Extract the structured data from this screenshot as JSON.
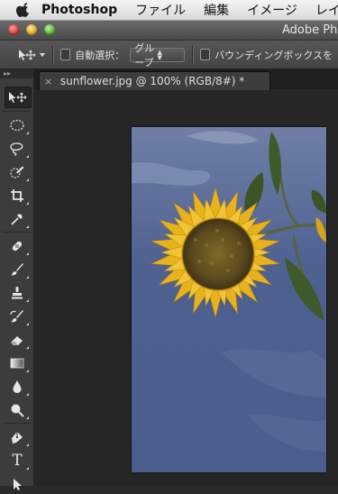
{
  "menubar": {
    "apple_icon": "apple-icon",
    "items": [
      "Photoshop",
      "ファイル",
      "編集",
      "イメージ",
      "レイ"
    ]
  },
  "window": {
    "title": "Adobe Pho"
  },
  "options": {
    "auto_select_label": "自動選択：",
    "auto_select_value": "グループ",
    "bounding_box_label": "バウンディングボックスを"
  },
  "toolbar": {
    "header": "▸▸",
    "tools": [
      {
        "name": "move-tool",
        "icon": "move-icon",
        "active": true
      },
      {
        "name": "marquee-tool",
        "icon": "elliptical-marquee-icon"
      },
      {
        "name": "lasso-tool",
        "icon": "lasso-icon"
      },
      {
        "name": "quick-selection-tool",
        "icon": "quick-selection-icon"
      },
      {
        "name": "crop-tool",
        "icon": "crop-icon"
      },
      {
        "name": "eyedropper-tool",
        "icon": "eyedropper-icon"
      },
      {
        "name": "healing-brush-tool",
        "icon": "bandage-icon"
      },
      {
        "name": "brush-tool",
        "icon": "brush-icon"
      },
      {
        "name": "clone-stamp-tool",
        "icon": "stamp-icon"
      },
      {
        "name": "history-brush-tool",
        "icon": "history-brush-icon"
      },
      {
        "name": "eraser-tool",
        "icon": "eraser-icon"
      },
      {
        "name": "gradient-tool",
        "icon": "gradient-icon"
      },
      {
        "name": "blur-tool",
        "icon": "blur-drop-icon"
      },
      {
        "name": "dodge-tool",
        "icon": "dodge-icon"
      },
      {
        "name": "pen-tool",
        "icon": "pen-icon"
      },
      {
        "name": "type-tool",
        "icon": "type-icon",
        "label": "T"
      },
      {
        "name": "path-selection-tool",
        "icon": "path-selection-icon"
      }
    ]
  },
  "document": {
    "tab_close": "×",
    "tab_title": "sunflower.jpg @ 100% (RGB/8#) *",
    "image_subject": "sunflower-photo"
  },
  "colors": {
    "sky": "#4a5e8e",
    "petal": "#e8b21c",
    "flower_center": "#5a4a1c",
    "leaf": "#3f5a2a"
  }
}
